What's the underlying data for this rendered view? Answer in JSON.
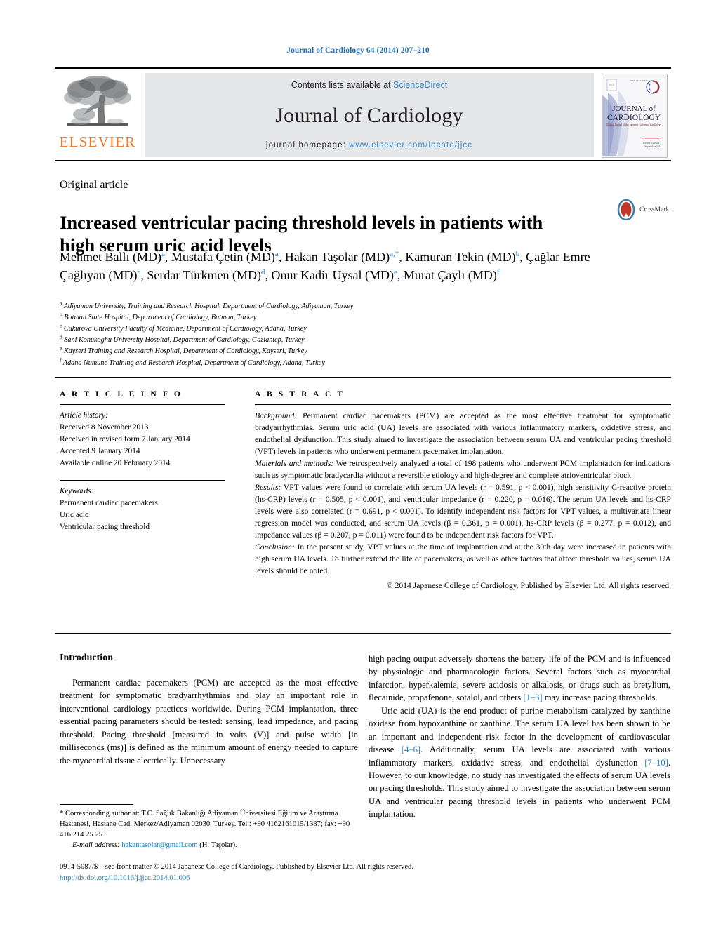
{
  "running_head": "Journal of Cardiology 64 (2014) 207–210",
  "masthead": {
    "publisher_logo_text": "ELSEVIER",
    "contents_prefix": "Contents lists available at ",
    "contents_link": "ScienceDirect",
    "journal_title": "Journal of Cardiology",
    "homepage_prefix": "journal homepage: ",
    "homepage_url": "www.elsevier.com/locate/jjcc",
    "cover_title_line1": "JOURNAL of",
    "cover_title_line2": "CARDIOLOGY",
    "cover_subtitle": "Official Journal of the Japanese College of Cardiology",
    "cover_volume": "Volume 64 Issue 3",
    "cover_date": "September 2014"
  },
  "article": {
    "kicker": "Original article",
    "title": "Increased ventricular pacing threshold levels in patients with high serum uric acid levels",
    "crossmark_label": "CrossMark",
    "authors_html": "Mehmet Ballı (MD)<sup>a</sup>, Mustafa Çetin (MD)<sup>a</sup>, Hakan Taşolar (MD)<sup>a,*</sup>, Kamuran Tekin (MD)<sup>b</sup>, Çağlar Emre Çağlıyan (MD)<sup>c</sup>, Serdar Türkmen (MD)<sup>d</sup>, Onur Kadir Uysal (MD)<sup>e</sup>, Murat Çaylı (MD)<sup>f</sup>",
    "affiliations": [
      {
        "mark": "a",
        "text": "Adiyaman University, Training and Research Hospital, Department of Cardiology, Adiyaman, Turkey"
      },
      {
        "mark": "b",
        "text": "Batman State Hospital, Department of Cardiology, Batman, Turkey"
      },
      {
        "mark": "c",
        "text": "Cukurova University Faculty of Medicine, Department of Cardiology, Adana, Turkey"
      },
      {
        "mark": "d",
        "text": "Sani Konukoghu University Hospital, Department of Cardiology, Gaziantep, Turkey"
      },
      {
        "mark": "e",
        "text": "Kayseri Training and Research Hospital, Department of Cardiology, Kayseri, Turkey"
      },
      {
        "mark": "f",
        "text": "Adana Numune Training and Research Hospital, Department of Cardiology, Adana, Turkey"
      }
    ]
  },
  "article_info": {
    "heading": "A R T I C L E   I N F O",
    "history_label": "Article history:",
    "history": [
      "Received 8 November 2013",
      "Received in revised form 7 January 2014",
      "Accepted 9 January 2014",
      "Available online 20 February 2014"
    ],
    "keywords_label": "Keywords:",
    "keywords": [
      "Permanent cardiac pacemakers",
      "Uric acid",
      "Ventricular pacing threshold"
    ]
  },
  "abstract": {
    "heading": "A B S T R A C T",
    "background_label": "Background:",
    "background_text": " Permanent cardiac pacemakers (PCM) are accepted as the most effective treatment for symptomatic bradyarrhythmias. Serum uric acid (UA) levels are associated with various inflammatory markers, oxidative stress, and endothelial dysfunction. This study aimed to investigate the association between serum UA and ventricular pacing threshold (VPT) levels in patients who underwent permanent pacemaker implantation.",
    "methods_label": "Materials and methods:",
    "methods_text": " We retrospectively analyzed a total of 198 patients who underwent PCM implantation for indications such as symptomatic bradycardia without a reversible etiology and high-degree and complete atrioventricular block.",
    "results_label": "Results:",
    "results_text": " VPT values were found to correlate with serum UA levels (r = 0.591, p < 0.001), high sensitivity C-reactive protein (hs-CRP) levels (r = 0.505, p < 0.001), and ventricular impedance (r = 0.220, p = 0.016). The serum UA levels and hs-CRP levels were also correlated (r = 0.691, p < 0.001). To identify independent risk factors for VPT values, a multivariate linear regression model was conducted, and serum UA levels (β = 0.361, p = 0.001), hs-CRP levels (β = 0.277, p = 0.012), and impedance values (β = 0.207, p = 0.011) were found to be independent risk factors for VPT.",
    "conclusion_label": "Conclusion:",
    "conclusion_text": " In the present study, VPT values at the time of implantation and at the 30th day were increased in patients with high serum UA levels. To further extend the life of pacemakers, as well as other factors that affect threshold values, serum UA levels should be noted.",
    "copyright": "© 2014 Japanese College of Cardiology. Published by Elsevier Ltd. All rights reserved."
  },
  "body": {
    "intro_heading": "Introduction",
    "left_para_1": "Permanent cardiac pacemakers (PCM) are accepted as the most effective treatment for symptomatic bradyarrhythmias and play an important role in interventional cardiology practices worldwide. During PCM implantation, three essential pacing parameters should be tested: sensing, lead impedance, and pacing threshold. Pacing threshold [measured in volts (V)] and pulse width [in milliseconds (ms)] is defined as the minimum amount of energy needed to capture the myocardial tissue electrically. Unnecessary",
    "right_para_1_a": "high pacing output adversely shortens the battery life of the PCM and is influenced by physiologic and pharmacologic factors. Several factors such as myocardial infarction, hyperkalemia, severe acidosis or alkalosis, or drugs such as bretylium, flecainide, propafenone, sotalol, and others ",
    "right_para_1_ref": "[1–3]",
    "right_para_1_b": " may increase pacing thresholds.",
    "right_para_2_a": "Uric acid (UA) is the end product of purine metabolism catalyzed by xanthine oxidase from hypoxanthine or xanthine. The serum UA level has been shown to be an important and independent risk factor in the development of cardiovascular disease ",
    "right_para_2_ref1": "[4–6]",
    "right_para_2_b": ". Additionally, serum UA levels are associated with various inflammatory markers, oxidative stress, and endothelial dysfunction ",
    "right_para_2_ref2": "[7–10]",
    "right_para_2_c": ". However, to our knowledge, no study has investigated the effects of serum UA levels on pacing thresholds. This study aimed to investigate the association between serum UA and ventricular pacing threshold levels in patients who underwent PCM implantation."
  },
  "footnote": {
    "star": "*",
    "corresponding_text": " Corresponding author at: T.C. Sağlık Bakanlığı Adiyaman Üniversitesi Eğitim ve Araştırma Hastanesi, Hastane Cad. Merkez/Adiyaman 02030, Turkey. Tel.: +90 4162161015/1387; fax: +90 416 214 25 25.",
    "email_label": "E-mail address:",
    "email": "hakantasolar@gmail.com",
    "email_suffix": " (H. Taşolar)."
  },
  "colophon": {
    "issn_line": "0914-5087/$ – see front matter © 2014 Japanese College of Cardiology. Published by Elsevier Ltd. All rights reserved.",
    "doi": "http://dx.doi.org/10.1016/j.jjcc.2014.01.006"
  },
  "colors": {
    "link_blue": "#1f7fc0",
    "header_blue": "#1f6fb5",
    "elsevier_orange": "#ee7624",
    "band_gray": "#e6e7e8"
  }
}
